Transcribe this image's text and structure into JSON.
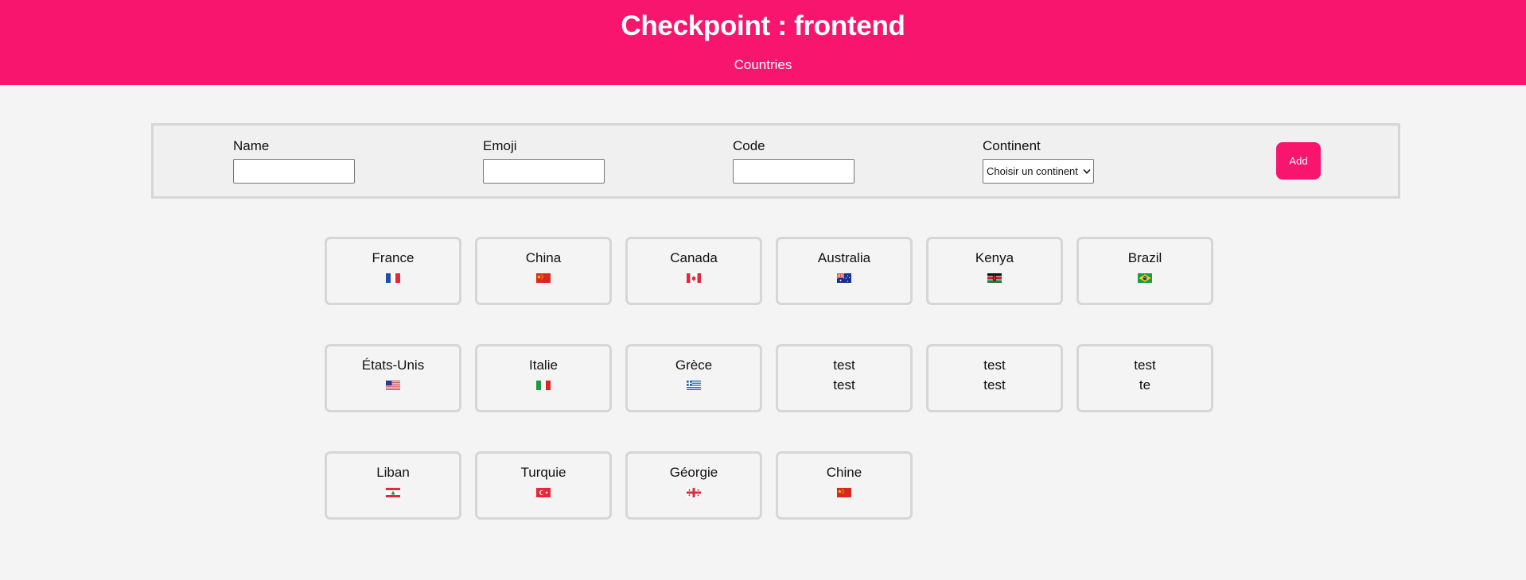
{
  "header": {
    "title": "Checkpoint : frontend",
    "nav_link": "Countries"
  },
  "colors": {
    "brand": "#f7156d",
    "background": "#f4f4f4",
    "card_border": "#d6d6d6"
  },
  "form": {
    "fields": [
      {
        "label": "Name",
        "value": ""
      },
      {
        "label": "Emoji",
        "value": ""
      },
      {
        "label": "Code",
        "value": ""
      }
    ],
    "continent": {
      "label": "Continent",
      "selected": "Choisir un continent",
      "icon": "chevron-down-icon"
    },
    "add_label": "Add"
  },
  "countries": [
    {
      "name": "France",
      "flag": "fr"
    },
    {
      "name": "China",
      "flag": "cn"
    },
    {
      "name": "Canada",
      "flag": "ca"
    },
    {
      "name": "Australia",
      "flag": "au"
    },
    {
      "name": "Kenya",
      "flag": "ke"
    },
    {
      "name": "Brazil",
      "flag": "br"
    },
    {
      "name": "États-Unis",
      "flag": "us"
    },
    {
      "name": "Italie",
      "flag": "it"
    },
    {
      "name": "Grèce",
      "flag": "gr"
    },
    {
      "name": "test",
      "emoji": "test"
    },
    {
      "name": "test",
      "emoji": "test"
    },
    {
      "name": "test",
      "emoji": "te"
    },
    {
      "name": "Liban",
      "flag": "lb"
    },
    {
      "name": "Turquie",
      "flag": "tr"
    },
    {
      "name": "Géorgie",
      "flag": "ge"
    },
    {
      "name": "Chine",
      "flag": "cn"
    }
  ]
}
